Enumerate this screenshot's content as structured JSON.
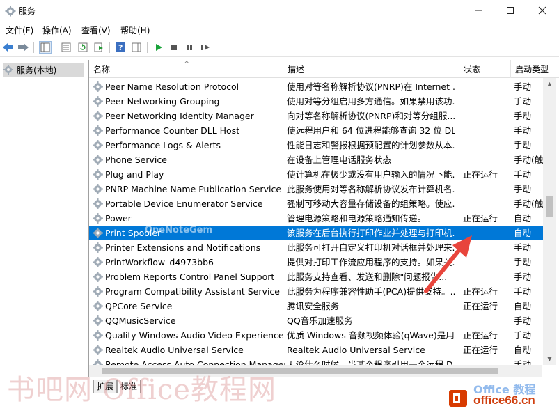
{
  "window": {
    "title": "服务"
  },
  "menu": {
    "items": [
      "文件(F)",
      "操作(A)",
      "查看(V)",
      "帮助(H)"
    ]
  },
  "tree": {
    "root_label": "服务(本地)"
  },
  "columns": {
    "name": "名称",
    "desc": "描述",
    "status": "状态",
    "startup": "启动类型"
  },
  "services": [
    {
      "name": "Peer Name Resolution Protocol",
      "desc": "使用对等名称解析协议(PNRP)在 Internet ...",
      "status": "",
      "startup": "手动"
    },
    {
      "name": "Peer Networking Grouping",
      "desc": "使用对等分组启用多方通信。如果禁用该功...",
      "status": "",
      "startup": "手动"
    },
    {
      "name": "Peer Networking Identity Manager",
      "desc": "向对等名称解析协议(PNRP)和对等分组服...",
      "status": "",
      "startup": "手动"
    },
    {
      "name": "Performance Counter DLL Host",
      "desc": "使远程用户和 64 位进程能够查询 32 位 DL...",
      "status": "",
      "startup": "手动"
    },
    {
      "name": "Performance Logs & Alerts",
      "desc": "性能日志和警报根据预配置的计划参数从本...",
      "status": "",
      "startup": "手动"
    },
    {
      "name": "Phone Service",
      "desc": "在设备上管理电话服务状态",
      "status": "",
      "startup": "手动(触"
    },
    {
      "name": "Plug and Play",
      "desc": "使计算机在极少或没有用户输入的情况下能...",
      "status": "正在运行",
      "startup": "手动"
    },
    {
      "name": "PNRP Machine Name Publication Service",
      "desc": "此服务使用对等名称解析协议发布计算机名...",
      "status": "",
      "startup": "手动"
    },
    {
      "name": "Portable Device Enumerator Service",
      "desc": "强制可移动大容量存储设备的组策略。使应...",
      "status": "",
      "startup": "手动(触"
    },
    {
      "name": "Power",
      "desc": "管理电源策略和电源策略通知传递。",
      "status": "正在运行",
      "startup": "自动"
    },
    {
      "name": "Print Spooler",
      "desc": "该服务在后台执行打印作业并处理与打印机...",
      "status": "",
      "startup": "自动",
      "selected": true
    },
    {
      "name": "Printer Extensions and Notifications",
      "desc": "此服务可打开自定义打印机对话框并处理来...",
      "status": "",
      "startup": "手动"
    },
    {
      "name": "PrintWorkflow_d4973bb6",
      "desc": "提供对打印工作流应用程序的支持。如果关...",
      "status": "",
      "startup": "手动"
    },
    {
      "name": "Problem Reports Control Panel Support",
      "desc": "此服务支持查看、发送和删除\"问题报告...",
      "status": "",
      "startup": "手动"
    },
    {
      "name": "Program Compatibility Assistant Service",
      "desc": "此服务为程序兼容性助手(PCA)提供支持。...",
      "status": "正在运行",
      "startup": "手动"
    },
    {
      "name": "QPCore Service",
      "desc": "腾讯安全服务",
      "status": "正在运行",
      "startup": "自动"
    },
    {
      "name": "QQMusicService",
      "desc": "QQ音乐加速服务",
      "status": "",
      "startup": "手动"
    },
    {
      "name": "Quality Windows Audio Video Experience",
      "desc": "优质 Windows 音频视频体验(qWave)是用...",
      "status": "正在运行",
      "startup": "手动"
    },
    {
      "name": "Realtek Audio Universal Service",
      "desc": "Realtek Audio Universal Service",
      "status": "正在运行",
      "startup": "自动"
    },
    {
      "name": "Remote Access Auto Connection Manager",
      "desc": "无论什么时候，当某个程序引用一个远程 D...",
      "status": "",
      "startup": "手动"
    }
  ],
  "tabs": {
    "extended": "扩展",
    "standard": "标准"
  },
  "watermarks": {
    "left": "书吧网 Office教程网",
    "onenote": "OneNoteGem",
    "office": "office66.cn",
    "blue": "Office 教程"
  },
  "colors": {
    "selection": "#0078d7",
    "arrow": "#e8453c",
    "start": "#1aa33a"
  }
}
